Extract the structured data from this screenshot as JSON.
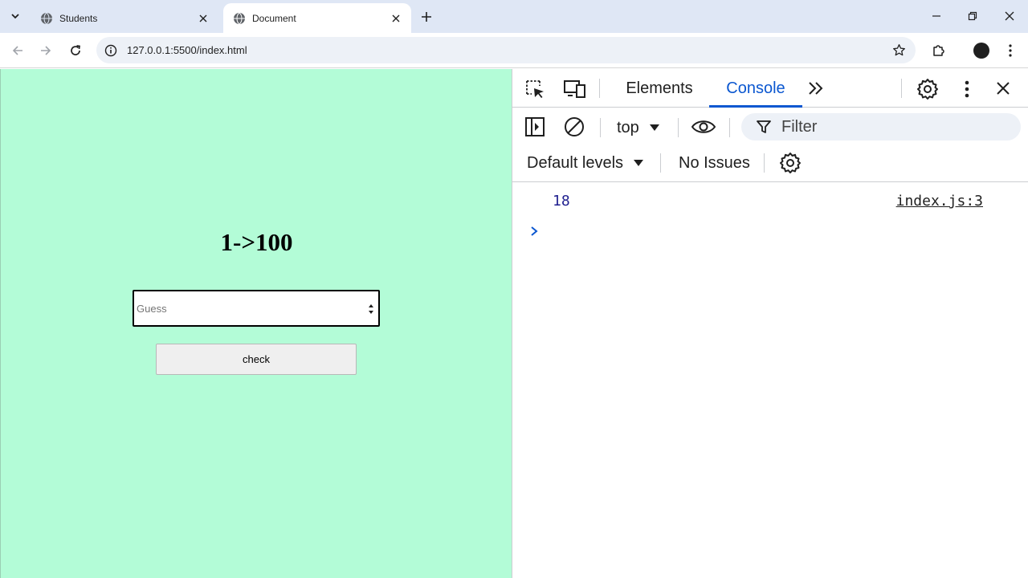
{
  "browser": {
    "tabs": [
      {
        "title": "Students",
        "active": false
      },
      {
        "title": "Document",
        "active": true
      }
    ],
    "url": "127.0.0.1:5500/index.html"
  },
  "page": {
    "background": "#b3fcd7",
    "heading": "1->100",
    "guess_placeholder": "Guess",
    "check_label": "check"
  },
  "devtools": {
    "tabs": [
      {
        "label": "Elements",
        "active": false
      },
      {
        "label": "Console",
        "active": true
      }
    ],
    "context": "top",
    "filter_placeholder": "Filter",
    "levels_label": "Default levels",
    "issues_label": "No Issues",
    "messages": [
      {
        "value": "18",
        "source": "index.js:3"
      }
    ],
    "accent": "#0b57d0"
  }
}
